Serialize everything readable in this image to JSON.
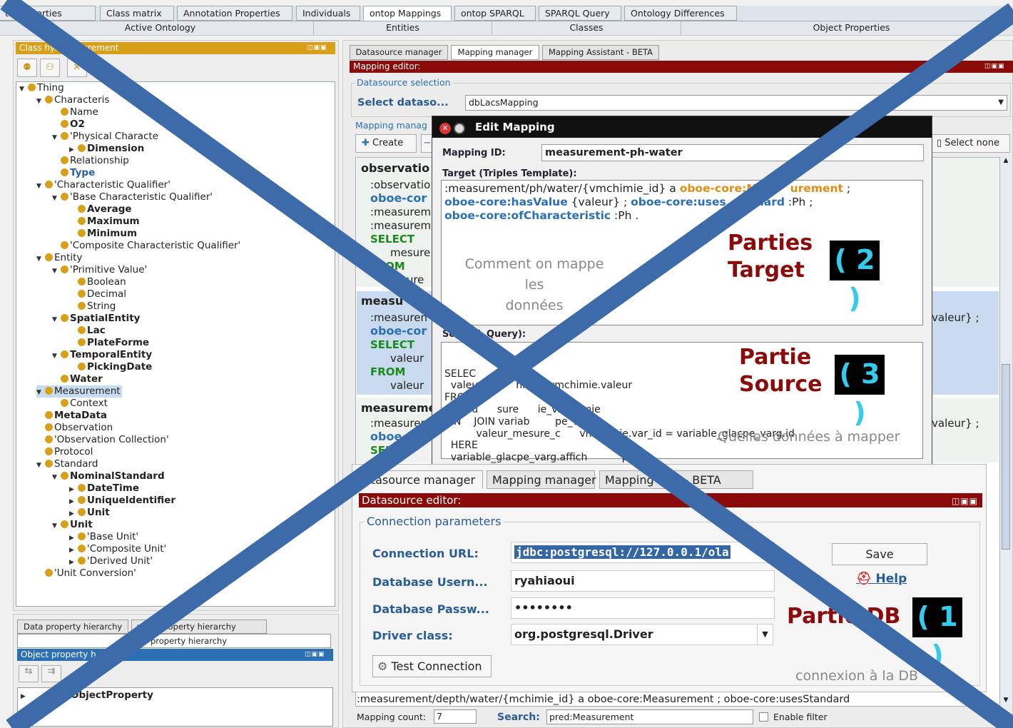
{
  "top_tabs": [
    "ta Properties",
    "Class matrix",
    "Annotation Properties",
    "Individuals",
    "ontop Mappings",
    "ontop SPARQL",
    "SPARQL Query",
    "Ontology Differences"
  ],
  "sub_tabs": [
    "Active Ontology",
    "Entities",
    "Classes",
    "Object Properties"
  ],
  "class_hierarchy": {
    "title": "Class       hy: Measurement",
    "nodes": {
      "thing": "Thing",
      "characteristic": "Characteris",
      "name": "Name",
      "o2": "O2",
      "physical": "'Physical Characte",
      "dimension": "Dimension",
      "relationship": "Relationship",
      "type": "Type",
      "cq": "'Characteristic Qualifier'",
      "bcq": "'Base Characteristic Qualifier'",
      "average": "Average",
      "maximum": "Maximum",
      "minimum": "Minimum",
      "ccq": "'Composite Characteristic Qualifier'",
      "entity": "Entity",
      "primitive": "'Primitive Value'",
      "boolean": "Boolean",
      "decimal": "Decimal",
      "string": "String",
      "spatial": "SpatialEntity",
      "lac": "Lac",
      "plateforme": "PlateForme",
      "temporal": "TemporalEntity",
      "pickingdate": "PickingDate",
      "water": "Water",
      "measurement": "Measurement",
      "context": "Context",
      "metadata": "MetaData",
      "observation": "Observation",
      "obscoll": "'Observation Collection'",
      "protocol": "Protocol",
      "standard": "Standard",
      "nominal": "NominalStandard",
      "datetime": "DateTime",
      "uid": "UniqueIdentifier",
      "unit1": "Unit",
      "unit2": "Unit",
      "baseunit": "'Base Unit'",
      "compunit": "'Composite Unit'",
      "derivedunit": "'Derived Unit'",
      "unitconv": "'Unit Conversion'"
    }
  },
  "lower_left": {
    "tab1": "Data property hierarchy",
    "tab2": "    ation property hierarchy",
    "tab3": "property hierarchy",
    "title": "Object property h      chy:",
    "root": "ObjectProperty"
  },
  "mapping": {
    "tabs": [
      "Datasource manager",
      "Mapping manager",
      "Mapping Assistant - BETA"
    ],
    "editor_title": "Mapping editor:",
    "ds_selection": "Datasource selection",
    "select_label": "Select dataso...",
    "select_value": "dbLacsMapping",
    "manager_label": "Mapping manag",
    "create": "Create",
    "select_none": "Select none",
    "entry1": {
      "id": "observatio",
      "l1": ":observatio",
      "l2": "oboe-cor",
      "l3": ":measurem",
      "l4": ":measurem",
      "l5": "SELECT",
      "l6": "mesure",
      "l7": "OM",
      "l8": "sure"
    },
    "entry2": {
      "id": "measu",
      "l1": ":measuren",
      "l2": "oboe-cor",
      "l3": "SELECT",
      "l4": "valeur",
      "l5": "FROM",
      "l6": "valeur",
      "right": "valeur} ;"
    },
    "entry3": {
      "id": "measureme",
      "l1": ":measuren",
      "l2": "oboe-",
      "l3": "SEL",
      "right": "valeur} ;"
    },
    "bottom_line": ":measurement/depth/water/{mchimie_id} a oboe-core:Measurement ; oboe-core:usesStandard",
    "count_label": "Mapping count:",
    "count": "7",
    "search_label": "Search:",
    "search_value": "pred:Measurement",
    "filter": "Enable filter"
  },
  "edit_mapping": {
    "title": "Edit Mapping",
    "id_label": "Mapping ID:",
    "id_value": "measurement-ph-water",
    "target_label": "Target (Triples Template):",
    "t1a": ":measurement/ph/water/{vmchimie_id} a ",
    "t1b": "oboe-core:M",
    "t1c": "urement",
    "t2a": "oboe-core:hasValue",
    "t2b": " {valeur} ; ",
    "t2c": "oboe-core:uses",
    "t2d": "dard",
    "t3": "oboe-core:ofCharacteristic",
    "source_label": "So      (SQL Query):",
    "sql": [
      "SELEC",
      "  valeur_m      himie_vmchimie.valeur",
      "FROM",
      "  valeu      sure      ie_vmchimie",
      "  IN    JOIN variab        pe_varg",
      "          valeur_mesure_c      vmchimie.var_id = variable_glacpe_varg.id",
      "  HERE",
      "  variable_glacpe_varg.affich          'pH'"
    ],
    "parties_target": [
      "Parties",
      "Target"
    ],
    "num2": "( 2 )",
    "comment": [
      "Comment on mappe les",
      "données"
    ],
    "partie_source": [
      "Partie",
      "Source"
    ],
    "num3": "( 3 )",
    "quelles": "Quelles données à mapper"
  },
  "datasource": {
    "tabs": [
      "atasource manager",
      "Mapping manager",
      "Mapping      tant - BETA"
    ],
    "editor": "Datasource editor:",
    "conn": "Connection parameters",
    "url_label": "Connection URL:",
    "url": "jdbc:postgresql://127.0.0.1/ola",
    "user_label": "Database Usern...",
    "user": "ryahiaoui",
    "pass_label": "Database Passw...",
    "pass": "••••••••",
    "driver_label": "Driver class:",
    "driver": "org.postgresql.Driver",
    "save": "Save",
    "help": "Help",
    "test": "Test Connection",
    "partie_db": "Partie DB",
    "num1": "( 1 )",
    "connexion": "connexion à la DB"
  },
  "colors": {
    "cross": "#3d6aa8",
    "dark_red": "#8b0b0b",
    "orange_head": "#d8a018"
  }
}
